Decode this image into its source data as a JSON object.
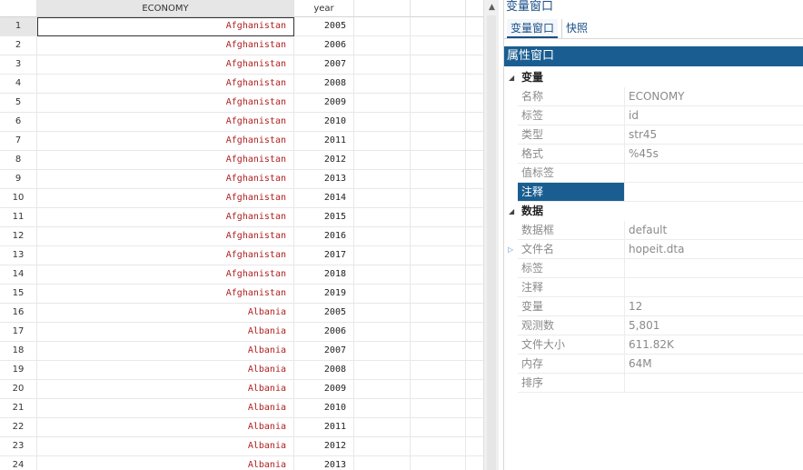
{
  "grid": {
    "columns": [
      "ECONOMY",
      "year"
    ],
    "rows": [
      {
        "n": "1",
        "economy": "Afghanistan",
        "year": "2005"
      },
      {
        "n": "2",
        "economy": "Afghanistan",
        "year": "2006"
      },
      {
        "n": "3",
        "economy": "Afghanistan",
        "year": "2007"
      },
      {
        "n": "4",
        "economy": "Afghanistan",
        "year": "2008"
      },
      {
        "n": "5",
        "economy": "Afghanistan",
        "year": "2009"
      },
      {
        "n": "6",
        "economy": "Afghanistan",
        "year": "2010"
      },
      {
        "n": "7",
        "economy": "Afghanistan",
        "year": "2011"
      },
      {
        "n": "8",
        "economy": "Afghanistan",
        "year": "2012"
      },
      {
        "n": "9",
        "economy": "Afghanistan",
        "year": "2013"
      },
      {
        "n": "10",
        "economy": "Afghanistan",
        "year": "2014"
      },
      {
        "n": "11",
        "economy": "Afghanistan",
        "year": "2015"
      },
      {
        "n": "12",
        "economy": "Afghanistan",
        "year": "2016"
      },
      {
        "n": "13",
        "economy": "Afghanistan",
        "year": "2017"
      },
      {
        "n": "14",
        "economy": "Afghanistan",
        "year": "2018"
      },
      {
        "n": "15",
        "economy": "Afghanistan",
        "year": "2019"
      },
      {
        "n": "16",
        "economy": "Albania",
        "year": "2005"
      },
      {
        "n": "17",
        "economy": "Albania",
        "year": "2006"
      },
      {
        "n": "18",
        "economy": "Albania",
        "year": "2007"
      },
      {
        "n": "19",
        "economy": "Albania",
        "year": "2008"
      },
      {
        "n": "20",
        "economy": "Albania",
        "year": "2009"
      },
      {
        "n": "21",
        "economy": "Albania",
        "year": "2010"
      },
      {
        "n": "22",
        "economy": "Albania",
        "year": "2011"
      },
      {
        "n": "23",
        "economy": "Albania",
        "year": "2012"
      },
      {
        "n": "24",
        "economy": "Albania",
        "year": "2013"
      }
    ],
    "selected_row": 1,
    "string_color": "#b02020"
  },
  "variables_window": {
    "title": "变量窗口",
    "tabs": [
      "变量窗口",
      "快照"
    ]
  },
  "properties_window": {
    "title": "属性窗口",
    "sections": [
      {
        "label": "变量",
        "rows": [
          {
            "name": "名称",
            "value": "ECONOMY"
          },
          {
            "name": "标签",
            "value": "id"
          },
          {
            "name": "类型",
            "value": "str45"
          },
          {
            "name": "格式",
            "value": "%45s"
          },
          {
            "name": "值标签",
            "value": ""
          },
          {
            "name": "注释",
            "value": "",
            "highlighted": true
          }
        ]
      },
      {
        "label": "数据",
        "rows": [
          {
            "name": "数据框",
            "value": "default"
          },
          {
            "name": "文件名",
            "value": "hopeit.dta",
            "expandable": true
          },
          {
            "name": "标签",
            "value": ""
          },
          {
            "name": "注释",
            "value": ""
          },
          {
            "name": "变量",
            "value": "12"
          },
          {
            "name": "观测数",
            "value": "5,801"
          },
          {
            "name": "文件大小",
            "value": "611.82K"
          },
          {
            "name": "内存",
            "value": "64M"
          },
          {
            "name": "排序",
            "value": ""
          }
        ]
      }
    ],
    "accent_color": "#1a5e91"
  },
  "icons": {
    "scroll_up": "chevron-up-icon",
    "section_toggle": "triangle-down-icon",
    "expand_row": "triangle-right-icon"
  }
}
